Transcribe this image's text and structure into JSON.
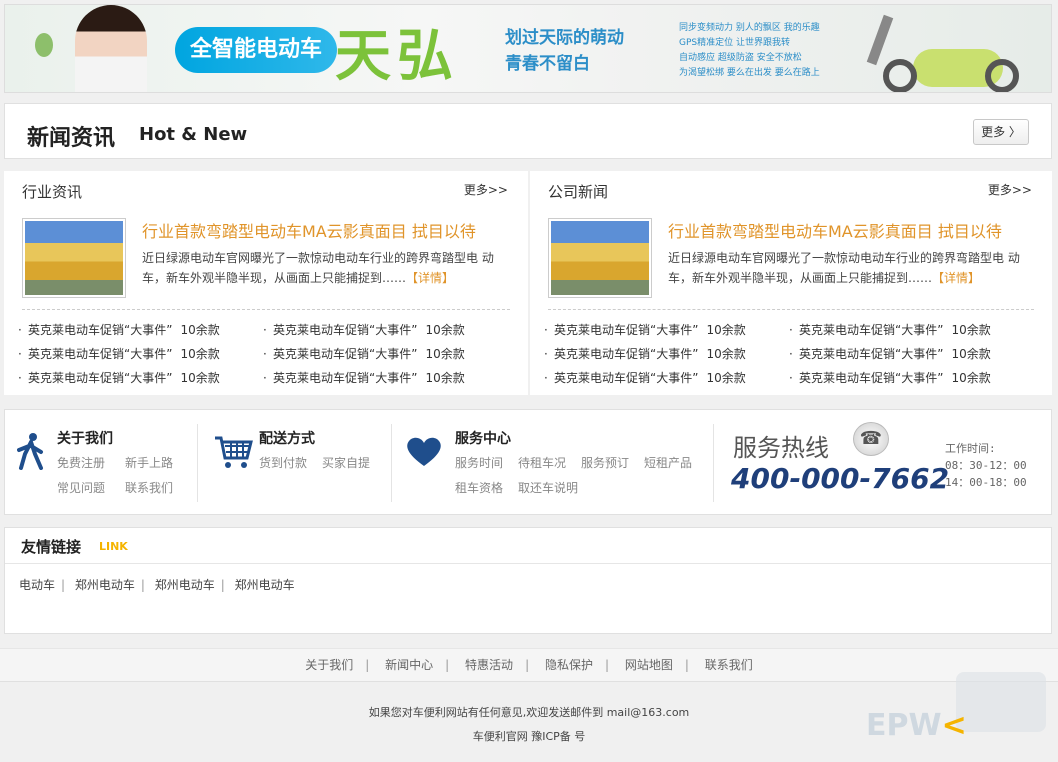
{
  "banner": {
    "pill": "全智能电动车",
    "brand": "天弘",
    "slogan_1": "划过天际的萌动",
    "slogan_2": "青春不留白",
    "features": [
      "同步变频动力 别人的飘区 我的乐趣",
      "GPS精准定位 让世界跟我转",
      "自动感应 超级防盗 安全不放松",
      "为渴望松绑 要么在出发 要么在路上"
    ]
  },
  "news_head": {
    "title": "新闻资讯",
    "subtitle": "Hot & New",
    "more": "更多 〉"
  },
  "industry": {
    "title": "行业资讯",
    "more": "更多>>",
    "headline": "行业首款弯踏型电动车MA云影真面目 拭目以待",
    "summary": "近日绿源电动车官网曝光了一款惊动电动车行业的跨界弯踏型电 动车，新车外观半隐半现，从画面上只能捕捉到……",
    "detail": "【详情】",
    "items": [
      {
        "text": "英克莱电动车促销“大事件”",
        "count": "10余款"
      },
      {
        "text": "英克莱电动车促销“大事件”",
        "count": "10余款"
      },
      {
        "text": "英克莱电动车促销“大事件”",
        "count": "10余款"
      },
      {
        "text": "英克莱电动车促销“大事件”",
        "count": "10余款"
      },
      {
        "text": "英克莱电动车促销“大事件”",
        "count": "10余款"
      },
      {
        "text": "英克莱电动车促销“大事件”",
        "count": "10余款"
      }
    ]
  },
  "company": {
    "title": "公司新闻",
    "more": "更多>>",
    "headline": "行业首款弯踏型电动车MA云影真面目 拭目以待",
    "summary": "近日绿源电动车官网曝光了一款惊动电动车行业的跨界弯踏型电 动车，新车外观半隐半现，从画面上只能捕捉到……",
    "detail": "【详情】",
    "items": [
      {
        "text": "英克莱电动车促销“大事件”",
        "count": "10余款"
      },
      {
        "text": "英克莱电动车促销“大事件”",
        "count": "10余款"
      },
      {
        "text": "英克莱电动车促销“大事件”",
        "count": "10余款"
      },
      {
        "text": "英克莱电动车促销“大事件”",
        "count": "10余款"
      },
      {
        "text": "英克莱电动车促销“大事件”",
        "count": "10余款"
      },
      {
        "text": "英克莱电动车促销“大事件”",
        "count": "10余款"
      }
    ]
  },
  "services": {
    "about": {
      "title": "关于我们",
      "links": [
        "免费注册",
        "新手上路",
        "常见问题",
        "联系我们"
      ]
    },
    "delivery": {
      "title": "配送方式",
      "links": [
        "货到付款",
        "买家自提"
      ]
    },
    "center": {
      "title": "服务中心",
      "links": [
        "服务时间",
        "待租车况",
        "服务预订",
        "短租产品",
        "租车资格",
        "取还车说明"
      ]
    },
    "hotline_label": "服务热线",
    "phone": "400-000-7662",
    "work_label": "工作时间:",
    "work_1": "08：30-12：00",
    "work_2": "14：00-18：00"
  },
  "friend_links": {
    "title": "友情链接",
    "sub": "LINK",
    "items": [
      "电动车",
      "郑州电动车",
      "郑州电动车",
      "郑州电动车"
    ]
  },
  "footer": {
    "nav": [
      "关于我们",
      "新闻中心",
      "特惠活动",
      "隐私保护",
      "网站地图",
      "联系我们"
    ],
    "feedback": "如果您对车便利网站有任何意见,欢迎发送邮件到 mail@163.com",
    "icp": "车便利官网 豫ICP备 号"
  },
  "watermark": "EPW"
}
